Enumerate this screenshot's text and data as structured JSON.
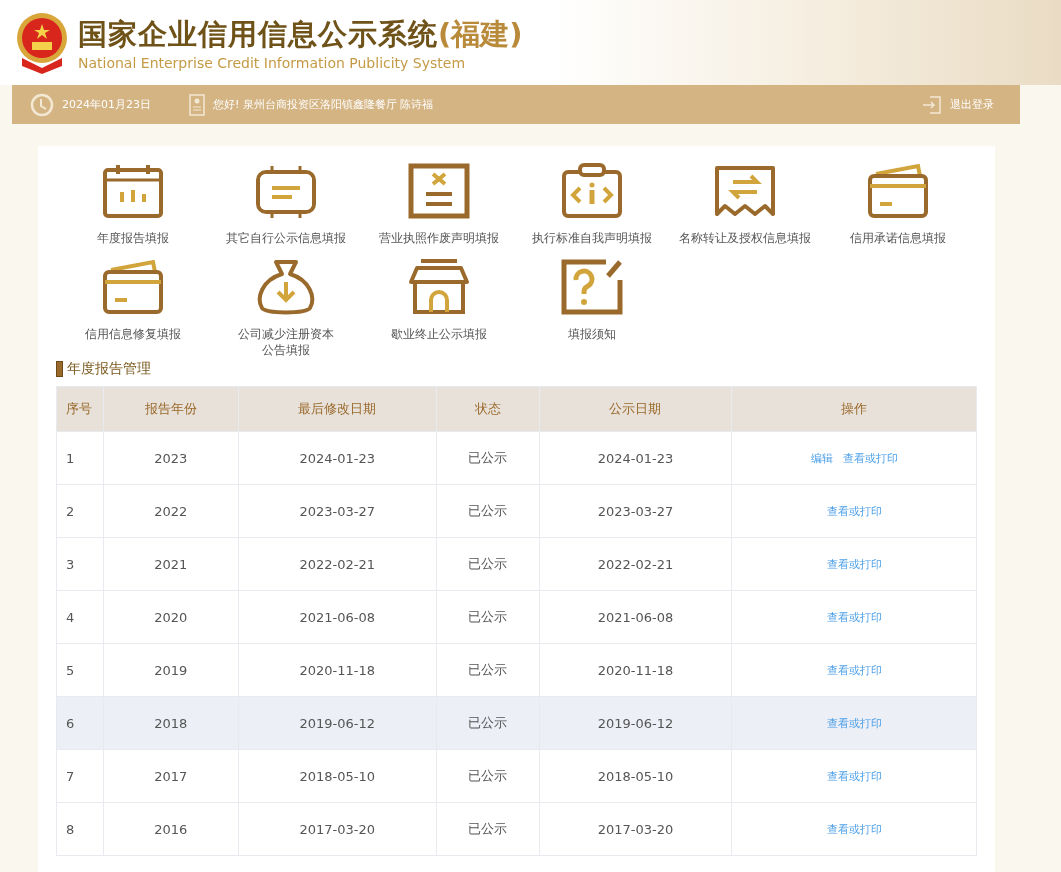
{
  "header": {
    "title": "国家企业信用信息公示系统",
    "region": "(福建)",
    "subtitle": "National Enterprise Credit Information Publicity System"
  },
  "info_bar": {
    "date": "2024年01月23日",
    "greeting": "您好!  泉州台商投资区洛阳镇鑫隆餐厅 陈诗福",
    "logout": "退出登录"
  },
  "tiles": [
    {
      "label": "年度报告填报"
    },
    {
      "label": "其它自行公示信息填报"
    },
    {
      "label": "营业执照作废声明填报"
    },
    {
      "label": "执行标准自我声明填报"
    },
    {
      "label": "名称转让及授权信息填报"
    },
    {
      "label": "信用承诺信息填报"
    },
    {
      "label": "信用信息修复填报"
    },
    {
      "label": "公司减少注册资本公告填报"
    },
    {
      "label": "歇业终止公示填报"
    },
    {
      "label": "填报须知"
    }
  ],
  "section": {
    "title": "年度报告管理"
  },
  "table": {
    "columns": [
      "序号",
      "报告年份",
      "最后修改日期",
      "状态",
      "公示日期",
      "操作"
    ],
    "rows": [
      {
        "cells": [
          "1",
          "2023",
          "2024-01-23",
          "已公示",
          "2024-01-23"
        ],
        "actions": [
          "编辑",
          "查看或打印"
        ],
        "highlighted": false
      },
      {
        "cells": [
          "2",
          "2022",
          "2023-03-27",
          "已公示",
          "2023-03-27"
        ],
        "actions": [
          "查看或打印"
        ],
        "highlighted": false
      },
      {
        "cells": [
          "3",
          "2021",
          "2022-02-21",
          "已公示",
          "2022-02-21"
        ],
        "actions": [
          "查看或打印"
        ],
        "highlighted": false
      },
      {
        "cells": [
          "4",
          "2020",
          "2021-06-08",
          "已公示",
          "2021-06-08"
        ],
        "actions": [
          "查看或打印"
        ],
        "highlighted": false
      },
      {
        "cells": [
          "5",
          "2019",
          "2020-11-18",
          "已公示",
          "2020-11-18"
        ],
        "actions": [
          "查看或打印"
        ],
        "highlighted": false
      },
      {
        "cells": [
          "6",
          "2018",
          "2019-06-12",
          "已公示",
          "2019-06-12"
        ],
        "actions": [
          "查看或打印"
        ],
        "highlighted": true
      },
      {
        "cells": [
          "7",
          "2017",
          "2018-05-10",
          "已公示",
          "2018-05-10"
        ],
        "actions": [
          "查看或打印"
        ],
        "highlighted": false
      },
      {
        "cells": [
          "8",
          "2016",
          "2017-03-20",
          "已公示",
          "2017-03-20"
        ],
        "actions": [
          "查看或打印"
        ],
        "highlighted": false
      }
    ]
  }
}
